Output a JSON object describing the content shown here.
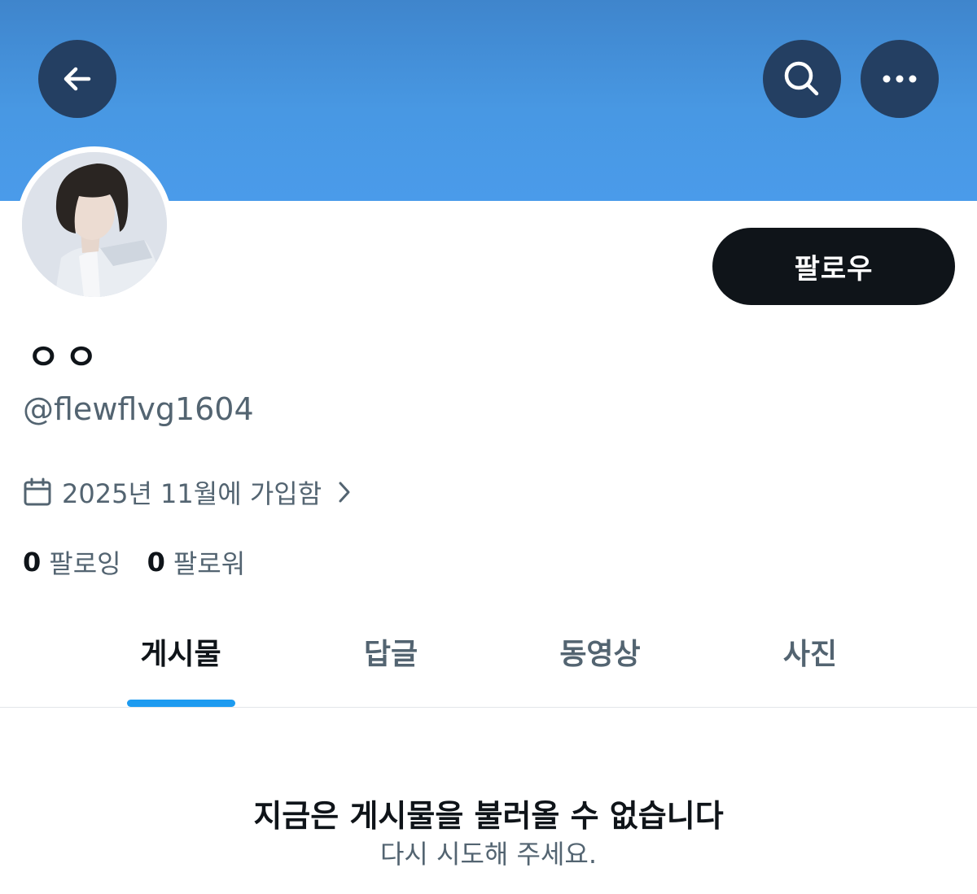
{
  "header": {
    "back_icon": "arrow-left-icon",
    "search_icon": "search-icon",
    "more_icon": "more-horizontal-icon",
    "banner_color": "#4898e3"
  },
  "profile": {
    "display_name": "ㅇㅇ",
    "handle": "@flewflvg1604",
    "joined": "2025년 11월에 가입함",
    "follow_label": "팔로우",
    "following_count": "0",
    "following_label": "팔로잉",
    "followers_count": "0",
    "followers_label": "팔로워"
  },
  "tabs": [
    {
      "label": "게시물",
      "active": true
    },
    {
      "label": "답글",
      "active": false
    },
    {
      "label": "동영상",
      "active": false
    },
    {
      "label": "사진",
      "active": false
    }
  ],
  "empty_state": {
    "title": "지금은 게시물을 불러올 수 없습니다",
    "subtitle": "다시 시도해 주세요."
  },
  "colors": {
    "accent": "#1d9bf0",
    "text_primary": "#0f1419",
    "text_secondary": "#536471",
    "button_dark": "#243f62"
  }
}
